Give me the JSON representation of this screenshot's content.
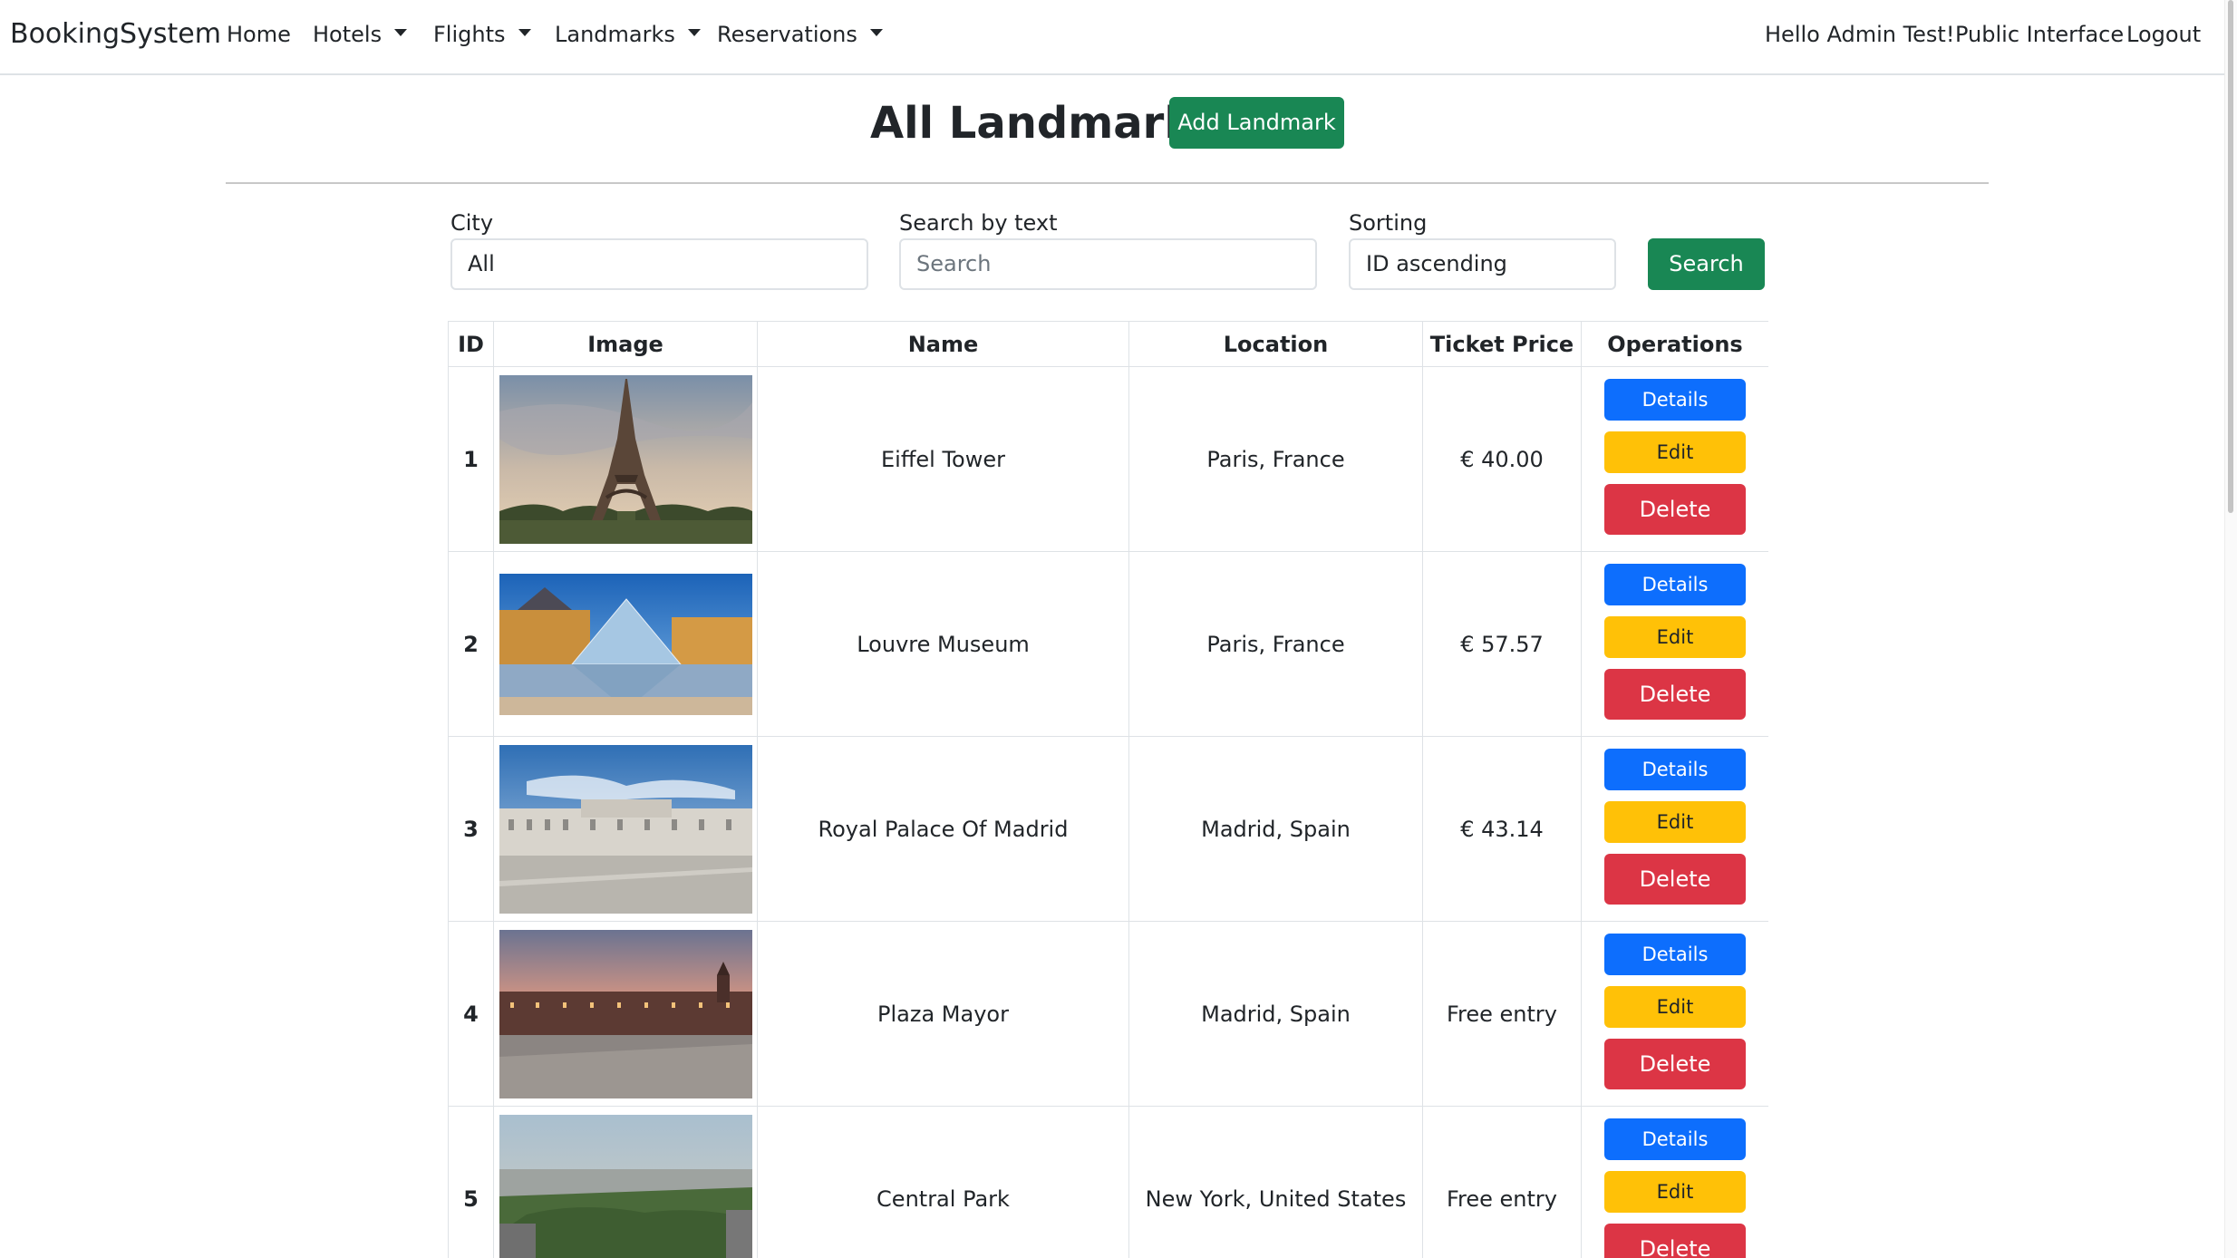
{
  "navbar": {
    "brand": "BookingSystem",
    "home": "Home",
    "hotels": "Hotels",
    "flights": "Flights",
    "landmarks": "Landmarks",
    "reservations": "Reservations",
    "greeting": "Hello Admin Test!",
    "public_interface": "Public Interface",
    "logout": "Logout"
  },
  "header": {
    "title": "All Landmarks",
    "add_button": "Add Landmark"
  },
  "filters": {
    "city_label": "City",
    "city_value": "All",
    "search_label": "Search by text",
    "search_placeholder": "Search",
    "sorting_label": "Sorting",
    "sorting_value": "ID ascending",
    "search_button": "Search"
  },
  "table": {
    "headers": [
      "ID",
      "Image",
      "Name",
      "Location",
      "Ticket Price",
      "Operations"
    ],
    "operations": {
      "details": "Details",
      "edit": "Edit",
      "delete": "Delete"
    },
    "rows": [
      {
        "id": "1",
        "name": "Eiffel Tower",
        "location": "Paris, France",
        "price": "€ 40.00",
        "image_icon": "eiffel-tower-photo"
      },
      {
        "id": "2",
        "name": "Louvre Museum",
        "location": "Paris, France",
        "price": "€ 57.57",
        "image_icon": "louvre-museum-photo"
      },
      {
        "id": "3",
        "name": "Royal Palace Of Madrid",
        "location": "Madrid, Spain",
        "price": "€ 43.14",
        "image_icon": "royal-palace-photo"
      },
      {
        "id": "4",
        "name": "Plaza Mayor",
        "location": "Madrid, Spain",
        "price": "Free entry",
        "image_icon": "plaza-mayor-photo"
      },
      {
        "id": "5",
        "name": "Central Park",
        "location": "New York, United States",
        "price": "Free entry",
        "image_icon": "central-park-photo"
      }
    ]
  },
  "colors": {
    "success": "#198754",
    "primary": "#0d6efd",
    "warning": "#ffc107",
    "danger": "#dc3545",
    "border": "#dee2e6"
  }
}
